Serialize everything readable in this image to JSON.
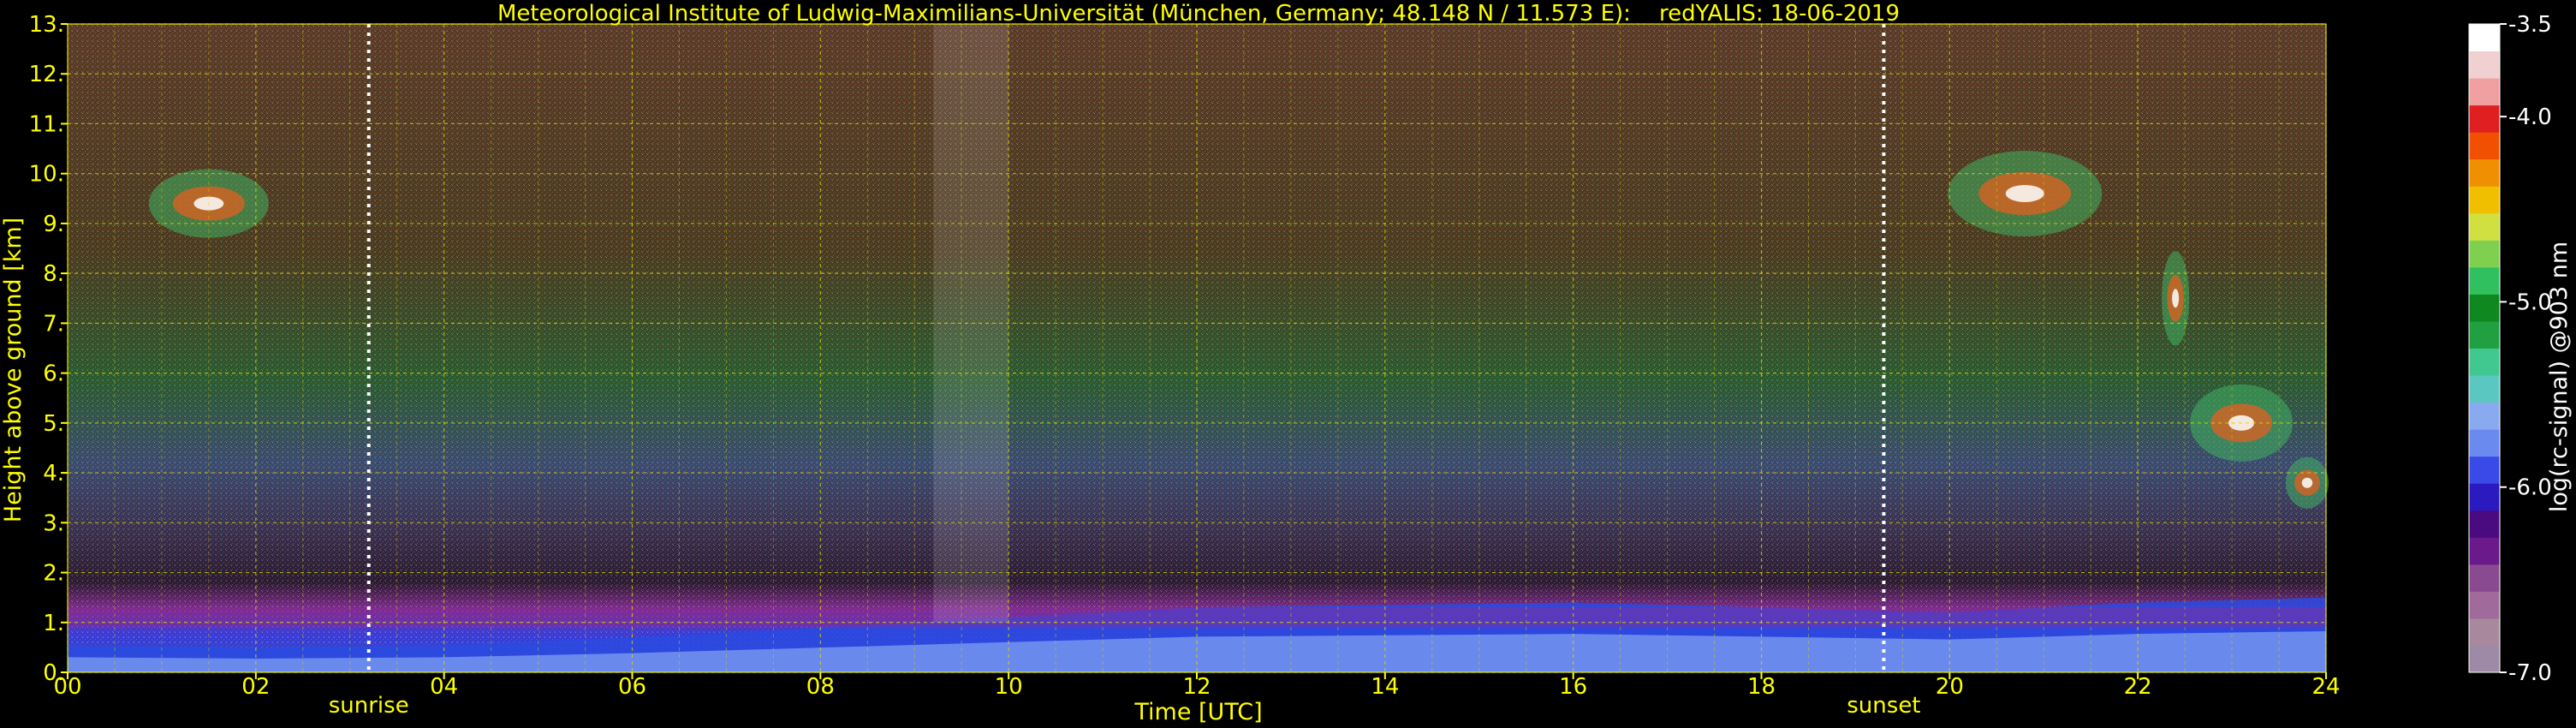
{
  "chart_data": {
    "type": "heatmap",
    "title": "Meteorological Institute of Ludwig-Maximilians-Universität (München, Germany; 48.148 N / 11.573 E):    redYALIS: 18-06-2019",
    "xlabel": "Time [UTC]",
    "ylabel": "Height above ground [km]",
    "xlim": [
      0,
      24
    ],
    "ylim": [
      0,
      13
    ],
    "x_ticks": [
      "00",
      "02",
      "04",
      "06",
      "08",
      "10",
      "12",
      "14",
      "16",
      "18",
      "20",
      "22",
      "24"
    ],
    "y_ticks": [
      "0.",
      "1.",
      "2.",
      "3.",
      "4.",
      "5.",
      "6.",
      "7.",
      "8.",
      "9.",
      "10.",
      "11.",
      "12.",
      "13."
    ],
    "grid": true,
    "sunrise": {
      "label": "sunrise",
      "time": 3.2
    },
    "sunset": {
      "label": "sunset",
      "time": 19.3
    },
    "colorbar": {
      "label": "log(rc-signal) @903 nm",
      "range": [
        -7.0,
        -3.5
      ],
      "ticks": [
        "-3.5",
        "-4.0",
        "-5.0",
        "-6.0",
        "-7.0"
      ],
      "colors": [
        "#9e8aa6",
        "#a8889c",
        "#a06a9a",
        "#8a4a90",
        "#6a1a8a",
        "#4a0a80",
        "#2a1ac0",
        "#3a4ae8",
        "#6a8af0",
        "#8aaaf0",
        "#5ac8c0",
        "#40c890",
        "#20a040",
        "#108820",
        "#30c060",
        "#80d050",
        "#d0e040",
        "#f0c000",
        "#f09000",
        "#f05000",
        "#e02020",
        "#f0a0a0",
        "#f0d0d0",
        "#ffffff"
      ]
    }
  },
  "colors": {
    "text": "#ffff00",
    "grid": "#d8d800",
    "background": "#000000"
  }
}
